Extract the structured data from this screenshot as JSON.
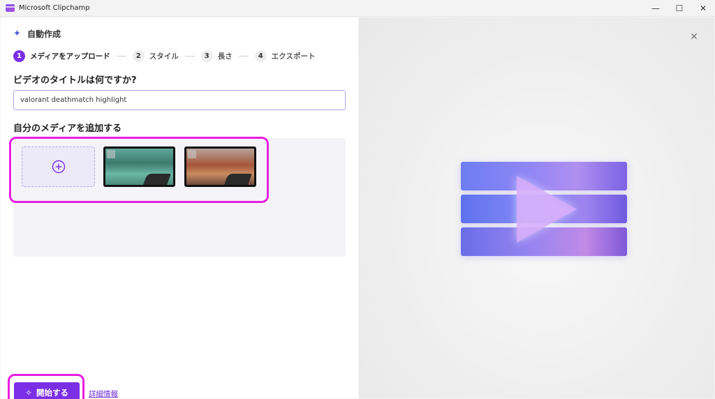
{
  "window": {
    "title": "Microsoft Clipchamp",
    "controls": [
      "—",
      "☐",
      "✕"
    ]
  },
  "header": {
    "icon": "sparkle-icon",
    "title": "自動作成"
  },
  "stepper": {
    "steps": [
      {
        "num": "1",
        "label": "メディアをアップロード",
        "active": true
      },
      {
        "num": "2",
        "label": "スタイル",
        "active": false
      },
      {
        "num": "3",
        "label": "長さ",
        "active": false
      },
      {
        "num": "4",
        "label": "エクスポート",
        "active": false
      }
    ]
  },
  "form": {
    "question": "ビデオのタイトルは何ですか?",
    "title_value": "valorant deathmatch highlight"
  },
  "media": {
    "heading": "自分のメディアを追加する",
    "add_icon": "plus-circle-icon",
    "clips": [
      "thumbnail-1",
      "thumbnail-2"
    ]
  },
  "footer": {
    "start_label": "開始する",
    "start_icon": "sparkle-icon",
    "details_link": "詳細情報"
  },
  "colors": {
    "accent": "#7a2ee6",
    "highlight": "#e81ee0"
  }
}
